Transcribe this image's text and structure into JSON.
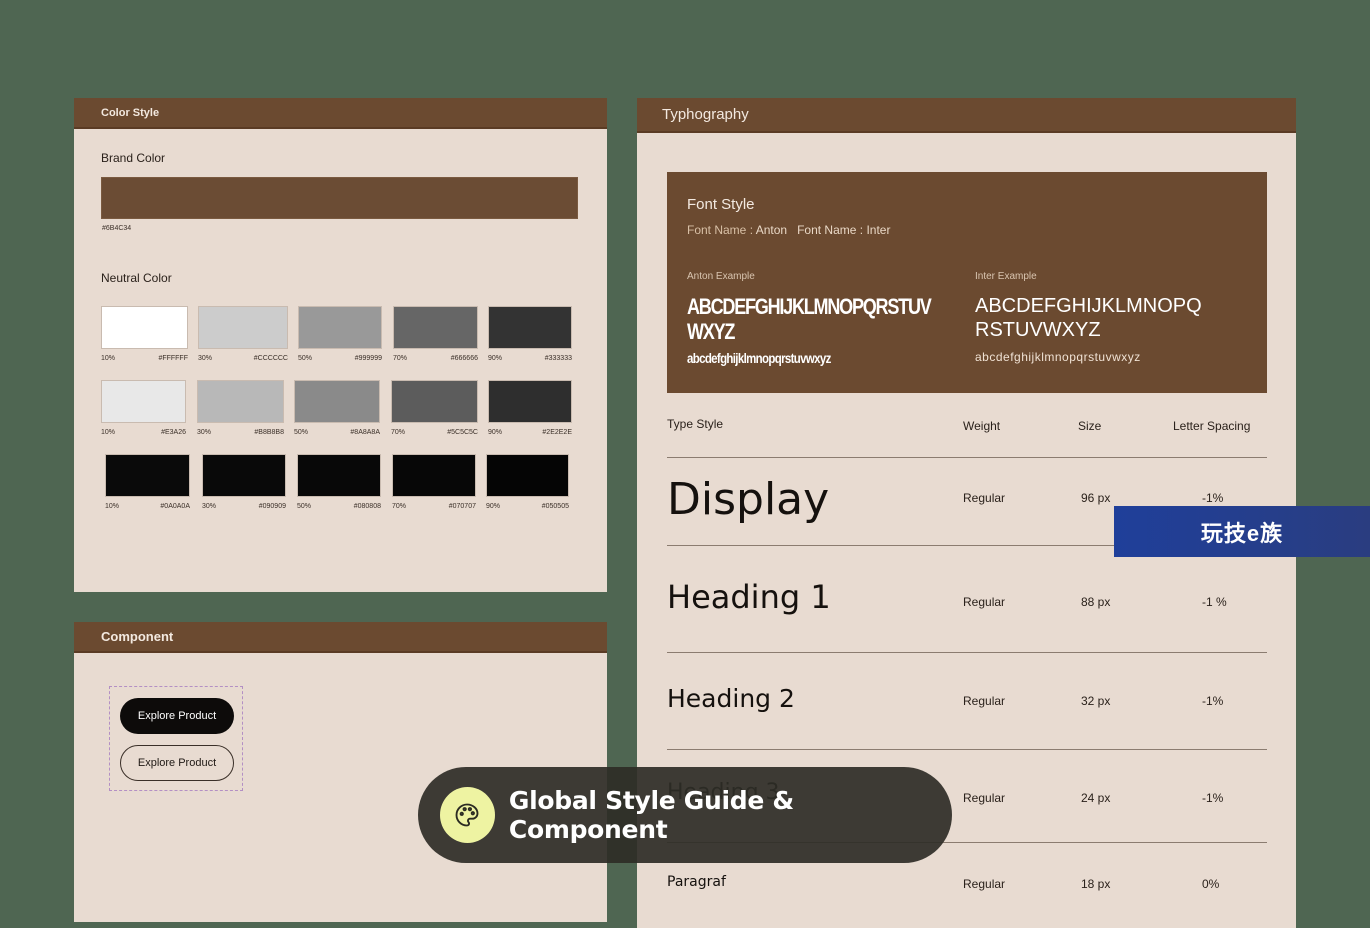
{
  "color_style": {
    "header": "Color Style",
    "brand_label": "Brand Color",
    "brand_color": "#6B4C34",
    "brand_hex": "#6B4C34",
    "neutral_label": "Neutral Color",
    "rows": [
      [
        {
          "pct": "10%",
          "hex": "#FFFFFF",
          "color": "#FFFFFF"
        },
        {
          "pct": "30%",
          "hex": "#CCCCCC",
          "color": "#CCCCCC"
        },
        {
          "pct": "50%",
          "hex": "#999999",
          "color": "#999999"
        },
        {
          "pct": "70%",
          "hex": "#666666",
          "color": "#666666"
        },
        {
          "pct": "90%",
          "hex": "#333333",
          "color": "#333333"
        }
      ],
      [
        {
          "pct": "10%",
          "hex": "#E3A26",
          "color": "#E8E8E8"
        },
        {
          "pct": "30%",
          "hex": "#B8B8B8",
          "color": "#B8B8B8"
        },
        {
          "pct": "50%",
          "hex": "#8A8A8A",
          "color": "#8A8A8A"
        },
        {
          "pct": "70%",
          "hex": "#5C5C5C",
          "color": "#5C5C5C"
        },
        {
          "pct": "90%",
          "hex": "#2E2E2E",
          "color": "#2E2E2E"
        }
      ],
      [
        {
          "pct": "10%",
          "hex": "#0A0A0A",
          "color": "#0A0A0A"
        },
        {
          "pct": "30%",
          "hex": "#090909",
          "color": "#090909"
        },
        {
          "pct": "50%",
          "hex": "#080808",
          "color": "#080808"
        },
        {
          "pct": "70%",
          "hex": "#070707",
          "color": "#070707"
        },
        {
          "pct": "90%",
          "hex": "#050505",
          "color": "#050505"
        }
      ]
    ]
  },
  "component": {
    "header": "Component",
    "primary_button": "Explore Product",
    "outline_button": "Explore Product"
  },
  "typography": {
    "header": "Typhography",
    "font_style": {
      "title": "Font Style",
      "font1_key": "Font Name : ",
      "font1_val": "Anton",
      "font2_key": "Font Name : ",
      "font2_val": "Inter",
      "anton_label": "Anton Example",
      "anton_upper": "ABCDEFGHIJKLMNOPQRSTUV WXYZ",
      "anton_lower": "abcdefghijklmnopqrstuvwxyz",
      "inter_label": "Inter Example",
      "inter_upper": "ABCDEFGHIJKLMNOPQ RSTUVWXYZ",
      "inter_lower": "abcdefghijklmnopqrstuvwxyz"
    },
    "columns": {
      "type_style": "Type Style",
      "weight": "Weight",
      "size": "Size",
      "letter_spacing": "Letter Spacing"
    },
    "rows": [
      {
        "name": "Display",
        "weight": "Regular",
        "size": "96 px",
        "spacing": "-1%"
      },
      {
        "name": "Heading 1",
        "weight": "Regular",
        "size": "88 px",
        "spacing": "-1 %"
      },
      {
        "name": "Heading 2",
        "weight": "Regular",
        "size": "32 px",
        "spacing": "-1%"
      },
      {
        "name": "Heading 3",
        "weight": "Regular",
        "size": "24 px",
        "spacing": "-1%"
      },
      {
        "name": "Paragraf",
        "weight": "Regular",
        "size": "18 px",
        "spacing": "0%"
      }
    ]
  },
  "watermark": "玩技e族",
  "banner": {
    "text": "Global Style Guide & Component",
    "icon": "palette-icon",
    "icon_bg": "#EEF3A2"
  }
}
